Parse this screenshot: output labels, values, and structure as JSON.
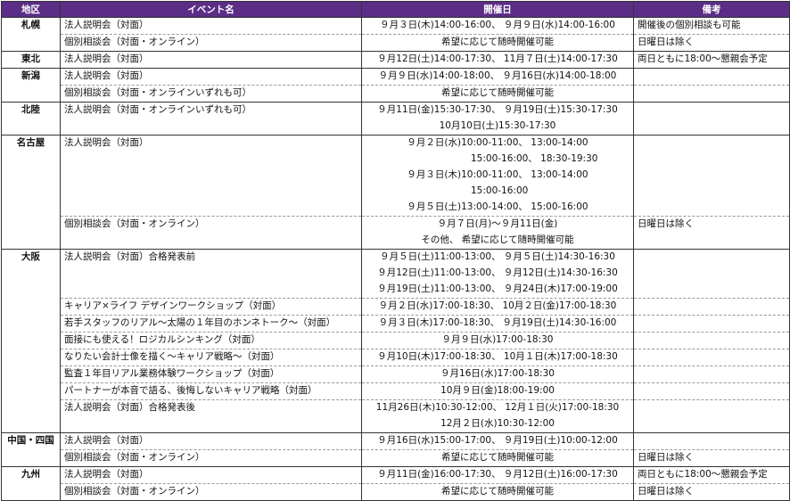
{
  "header": {
    "region": "地区",
    "event": "イベント名",
    "date": "開催日",
    "note": "備考"
  },
  "regions": [
    {
      "name": "札幌",
      "rows": [
        {
          "event": "法人説明会（対面）",
          "dates": [
            "９月３日(木)14:00-16:00、 ９月９日(水)14:00-16:00"
          ],
          "note": "開催後の個別相談も可能"
        },
        {
          "event": "個別相談会（対面・オンライン）",
          "dates": [
            "希望に応じて随時開催可能"
          ],
          "note": "日曜日は除く"
        }
      ]
    },
    {
      "name": "東北",
      "rows": [
        {
          "event": "法人説明会（対面）",
          "dates": [
            "９月12日(土)14:00-17:30、 11月７日(土)14:00-17:30"
          ],
          "note": "両日ともに18:00～懇親会予定"
        }
      ]
    },
    {
      "name": "新潟",
      "rows": [
        {
          "event": "法人説明会（対面）",
          "dates": [
            "９月９日(水)14:00-18:00、 ９月16日(水)14:00-18:00"
          ],
          "note": ""
        },
        {
          "event": "個別相談会（対面・オンラインいずれも可）",
          "dates": [
            "希望に応じて随時開催可能"
          ],
          "note": ""
        }
      ]
    },
    {
      "name": "北陸",
      "rows": [
        {
          "event": "法人説明会（対面・オンラインいずれも可）",
          "dates": [
            "９月11日(金)15:30-17:30、 ９月19日(土)15:30-17:30",
            "10月10日(土)15:30-17:30"
          ],
          "note": ""
        }
      ]
    },
    {
      "name": "名古屋",
      "rows": [
        {
          "event": "法人説明会（対面）",
          "dates": [
            "９月２日(水)10:00-11:00、 13:00-14:00",
            "15:00-16:00、 18:30-19:30",
            "９月３日(木)10:00-11:00、 13:00-14:00",
            "15:00-16:00",
            "９月５日(土)13:00-14:00、 15:00-16:00"
          ],
          "note": ""
        },
        {
          "event": "個別相談会（対面・オンライン）",
          "dates": [
            "９月７日(月)～９月11日(金)",
            "その他、 希望に応じて随時開催可能"
          ],
          "note": "日曜日は除く"
        }
      ]
    },
    {
      "name": "大阪",
      "rows": [
        {
          "event": "法人説明会（対面）合格発表前",
          "dates": [
            "９月５日(土)11:00-13:00、 ９月５日(土)14:30-16:30",
            "９月12日(土)11:00-13:00、 ９月12日(土)14:30-16:30",
            "９月19日(土)11:00-13:00、 ９月24日(木)17:00-19:00"
          ],
          "note": ""
        },
        {
          "event": "キャリア×ライフ デザインワークショップ（対面）",
          "dates": [
            "９月２日(水)17:00-18:30、 10月２日(金)17:00-18:30"
          ],
          "note": ""
        },
        {
          "event": "若手スタッフのリアル～太陽の１年目のホンネトーク～（対面）",
          "dates": [
            "９月３日(木)17:00-18:30、 ９月19日(土)14:30-16:00"
          ],
          "note": ""
        },
        {
          "event": "面接にも使える！ロジカルシンキング（対面）",
          "dates": [
            "９月９日(水)17:00-18:30"
          ],
          "note": ""
        },
        {
          "event": "なりたい会計士像を描く～キャリア戦略～（対面）",
          "dates": [
            "９月10日(木)17:00-18:30、 10月１日(木)17:00-18:30"
          ],
          "note": ""
        },
        {
          "event": "監査１年目リアル業務体験ワークショップ（対面）",
          "dates": [
            "９月16日(水)17:00-18:30"
          ],
          "note": ""
        },
        {
          "event": "パートナーが本音で語る、後悔しないキャリア戦略（対面）",
          "dates": [
            "10月９日(金)18:00-19:00"
          ],
          "note": ""
        },
        {
          "event": "法人説明会（対面）合格発表後",
          "dates": [
            "11月26日(木)10:30-12:00、 12月１日(火)17:00-18:30",
            "12月２日(水)10:30-12:00"
          ],
          "note": ""
        }
      ]
    },
    {
      "name": "中国・四国",
      "rows": [
        {
          "event": "法人説明会（対面）",
          "dates": [
            "９月16日(水)15:00-17:00、 ９月19日(土)10:00-12:00"
          ],
          "note": ""
        },
        {
          "event": "個別相談会（対面・オンライン）",
          "dates": [
            "希望に応じて随時開催可能"
          ],
          "note": "日曜日は除く"
        }
      ]
    },
    {
      "name": "九州",
      "rows": [
        {
          "event": "法人説明会（対面）",
          "dates": [
            "９月11日(金)16:00-17:30、 ９月12日(土)16:00-17:30"
          ],
          "note": "両日ともに18:00～懇親会予定"
        },
        {
          "event": "個別相談会（対面・オンライン）",
          "dates": [
            "希望に応じて随時開催可能"
          ],
          "note": "日曜日は除く"
        }
      ]
    }
  ]
}
